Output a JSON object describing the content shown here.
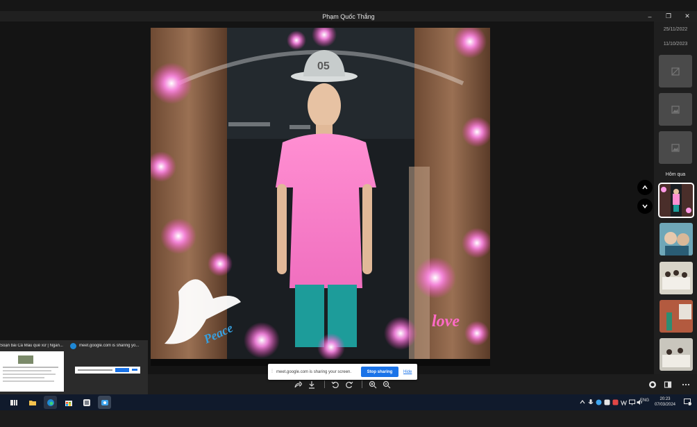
{
  "window": {
    "title": "Phạm Quốc Thắng",
    "minimize": "–",
    "restore": "❐",
    "close": "✕"
  },
  "photo": {
    "hat_number": "05",
    "overlay_left": "Peace",
    "overlay_right": "love"
  },
  "sidebar": {
    "dates": [
      "25/11/2022",
      "11/10/2023"
    ],
    "section_label": "Hôm qua"
  },
  "screen_share": {
    "grip": "⁞",
    "message": "meet.google.com is sharing your screen.",
    "stop_button": "Stop sharing",
    "hide_link": "Hide"
  },
  "task_previews": [
    {
      "title": "Soạn bài Cà Mau quê xứ | Ngắn..."
    },
    {
      "title": "meet.google.com is sharing yo..."
    }
  ],
  "taskbar": {
    "language": "ENG",
    "time": "20:23",
    "date": "07/03/2024",
    "notification_count": "2"
  },
  "colors": {
    "accent": "#1a73e8",
    "taskbar_bg": "#101a2c",
    "sidebar_bg": "#1f1f1f"
  }
}
